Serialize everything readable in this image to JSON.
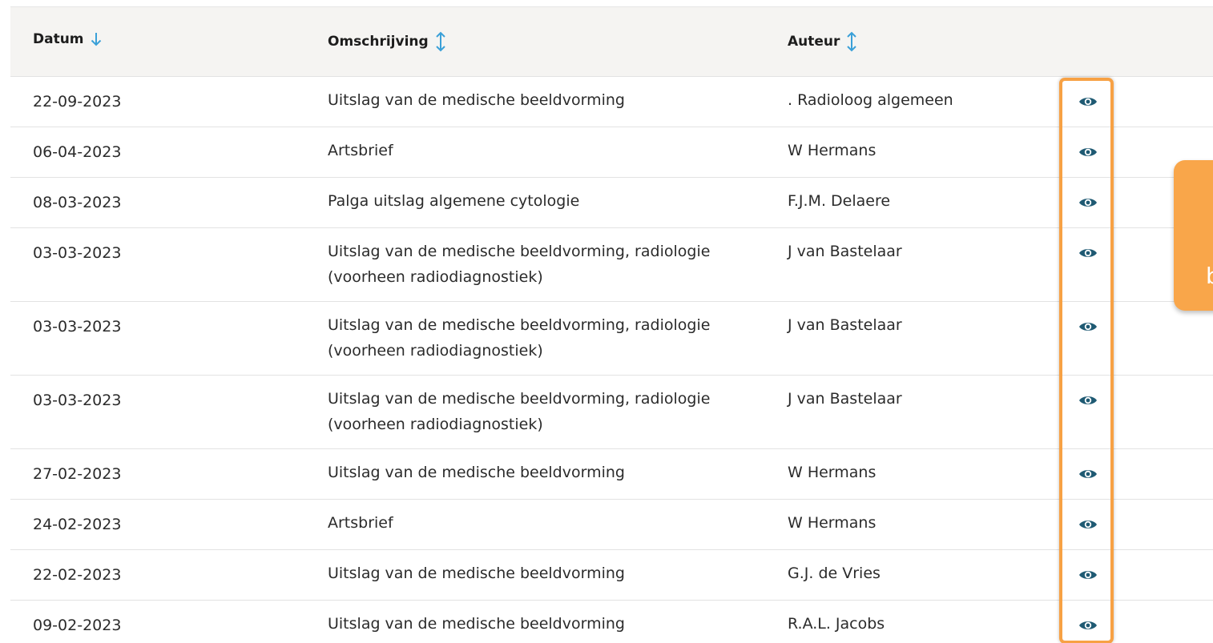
{
  "columns": {
    "date": "Datum",
    "description": "Omschrijving",
    "author": "Auteur"
  },
  "icons": {
    "sort_desc": "arrow-down-icon",
    "sort_both": "sort-vertical-icon",
    "view": "eye-icon"
  },
  "colors": {
    "accent": "#3aa0d8",
    "icon": "#1f5a73",
    "highlight": "#f7a144"
  },
  "rows": [
    {
      "date": "22-09-2023",
      "description": "Uitslag van de medische beeldvorming",
      "author": ". Radioloog algemeen"
    },
    {
      "date": "06-04-2023",
      "description": "Artsbrief",
      "author": "W Hermans"
    },
    {
      "date": "08-03-2023",
      "description": "Palga uitslag algemene cytologie",
      "author": "F.J.M. Delaere"
    },
    {
      "date": "03-03-2023",
      "description": "Uitslag van de medische beeldvorming, radiologie (voorheen radiodiagnostiek)",
      "author": "J van Bastelaar"
    },
    {
      "date": "03-03-2023",
      "description": "Uitslag van de medische beeldvorming, radiologie (voorheen radiodiagnostiek)",
      "author": "J van Bastelaar"
    },
    {
      "date": "03-03-2023",
      "description": "Uitslag van de medische beeldvorming, radiologie (voorheen radiodiagnostiek)",
      "author": "J van Bastelaar"
    },
    {
      "date": "27-02-2023",
      "description": "Uitslag van de medische beeldvorming",
      "author": "W Hermans"
    },
    {
      "date": "24-02-2023",
      "description": "Artsbrief",
      "author": "W Hermans"
    },
    {
      "date": "22-02-2023",
      "description": "Uitslag van de medische beeldvorming",
      "author": "G.J. de Vries"
    },
    {
      "date": "09-02-2023",
      "description": "Uitslag van de medische beeldvorming",
      "author": "R.A.L. Jacobs"
    }
  ],
  "tooltip": {
    "text": "b"
  }
}
